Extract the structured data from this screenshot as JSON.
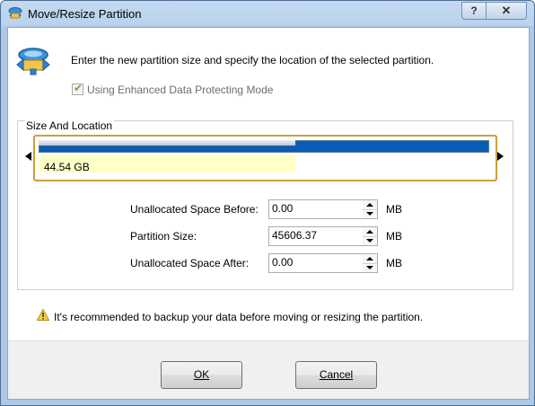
{
  "window": {
    "title": "Move/Resize Partition",
    "help_glyph": "?",
    "close_glyph": "✕"
  },
  "description": "Enter the new partition size and specify the location of the selected partition.",
  "checkbox": {
    "label": "Using Enhanced Data Protecting Mode",
    "checked": true
  },
  "group": {
    "title": "Size And Location"
  },
  "partition_bar": {
    "size_label": "44.54 GB",
    "used_fraction": 0.57
  },
  "fields": [
    {
      "label": "Unallocated Space Before:",
      "value": "0.00",
      "unit": "MB"
    },
    {
      "label": "Partition Size:",
      "value": "45606.37",
      "unit": "MB"
    },
    {
      "label": "Unallocated Space After:",
      "value": "0.00",
      "unit": "MB"
    }
  ],
  "warning": "It's recommended to backup your data before moving or resizing the partition.",
  "buttons": {
    "ok": "OK",
    "cancel": "Cancel"
  },
  "colors": {
    "bar_border": "#c9a040",
    "partition_blue": "#0a5db4",
    "used_fill": "#ffffc8"
  }
}
